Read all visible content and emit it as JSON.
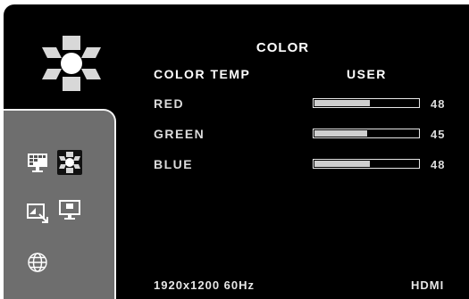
{
  "menu": {
    "title": "COLOR",
    "color_temp": {
      "label": "COLOR TEMP",
      "value": "USER"
    },
    "channels": [
      {
        "label": "RED",
        "value": 48,
        "level": 0.48,
        "display": "48"
      },
      {
        "label": "GREEN",
        "value": 45,
        "level": 0.45,
        "display": "45"
      },
      {
        "label": "BLUE",
        "value": 48,
        "level": 0.48,
        "display": "48"
      }
    ]
  },
  "sidebar": {
    "icons": [
      "picture-icon",
      "color-icon",
      "input-icon",
      "settings-icon",
      "language-icon"
    ],
    "selected": "color-icon"
  },
  "footer": {
    "resolution": "1920x1200 60Hz",
    "input": "HDMI"
  },
  "colors": {
    "background": "#000000",
    "sidebar": "#6e6e6e",
    "bar_fill": "#cfcfcf",
    "text": "#ffffff"
  }
}
